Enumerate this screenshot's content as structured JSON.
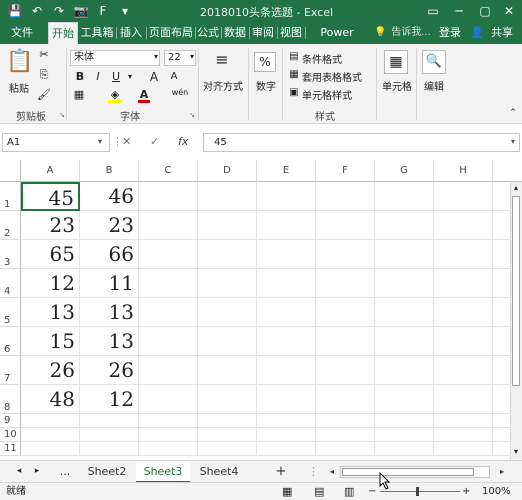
{
  "app": {
    "window_title": "2018010头条选题 - Excel",
    "accent_color": "#217346"
  },
  "quick_access": [
    {
      "icon": "save-icon",
      "glyph": "💾"
    },
    {
      "icon": "undo-icon",
      "glyph": "↶"
    },
    {
      "icon": "redo-icon",
      "glyph": "↷"
    },
    {
      "icon": "camera-icon",
      "glyph": "📷"
    },
    {
      "icon": "format-painter-icon",
      "glyph": "F"
    },
    {
      "icon": "customize-qat-icon",
      "glyph": "▾"
    }
  ],
  "window_controls": {
    "ribbon_display": "▭",
    "minimize": "─",
    "maximize": "▢",
    "close": "✕"
  },
  "tabs": [
    "文件",
    "开始",
    "工具箱",
    "插入",
    "页面布局",
    "公式",
    "数据",
    "审阅",
    "视图",
    "Power Pivot"
  ],
  "active_tab": "开始",
  "tell_me": "告诉我...",
  "login": "登录",
  "share": "共享",
  "ribbon": {
    "clipboard": {
      "label": "剪贴板",
      "paste": "粘贴"
    },
    "font": {
      "label": "字体",
      "font_name": "宋体",
      "font_size": "22",
      "bold": "B",
      "italic": "I",
      "underline": "U",
      "grow": "A",
      "shrink": "A",
      "font_color": "A",
      "highlight": "A",
      "phonetic": "wén",
      "font_color_value": "#d00000",
      "fill_color_value": "#ffff00"
    },
    "alignment": {
      "label": "对齐方式"
    },
    "number": {
      "label": "数字",
      "symbol": "%"
    },
    "styles": {
      "label": "样式",
      "conditional": "条件格式",
      "table": "套用表格格式",
      "cell_styles": "单元格样式"
    },
    "cells": {
      "label": "单元格"
    },
    "editing": {
      "label": "编辑"
    }
  },
  "formula_bar": {
    "name_box": "A1",
    "cancel": "✕",
    "enter": "✓",
    "fx": "fx",
    "value": "45"
  },
  "columns": [
    "A",
    "B",
    "C",
    "D",
    "E",
    "F",
    "G",
    "H"
  ],
  "rows": [
    {
      "n": "1",
      "a": "45",
      "b": "46"
    },
    {
      "n": "2",
      "a": "23",
      "b": "23"
    },
    {
      "n": "3",
      "a": "65",
      "b": "66"
    },
    {
      "n": "4",
      "a": "12",
      "b": "11"
    },
    {
      "n": "5",
      "a": "13",
      "b": "13"
    },
    {
      "n": "6",
      "a": "15",
      "b": "13"
    },
    {
      "n": "7",
      "a": "26",
      "b": "26"
    },
    {
      "n": "8",
      "a": "48",
      "b": "12"
    },
    {
      "n": "9",
      "a": "",
      "b": ""
    },
    {
      "n": "10",
      "a": "",
      "b": ""
    },
    {
      "n": "11",
      "a": "",
      "b": ""
    }
  ],
  "sheets": {
    "more": "...",
    "names": [
      "Sheet2",
      "Sheet3",
      "Sheet4"
    ],
    "active": "Sheet3",
    "add": "+"
  },
  "status": {
    "ready": "就绪",
    "zoom": "100%",
    "zoom_minus": "−",
    "zoom_plus": "+"
  }
}
